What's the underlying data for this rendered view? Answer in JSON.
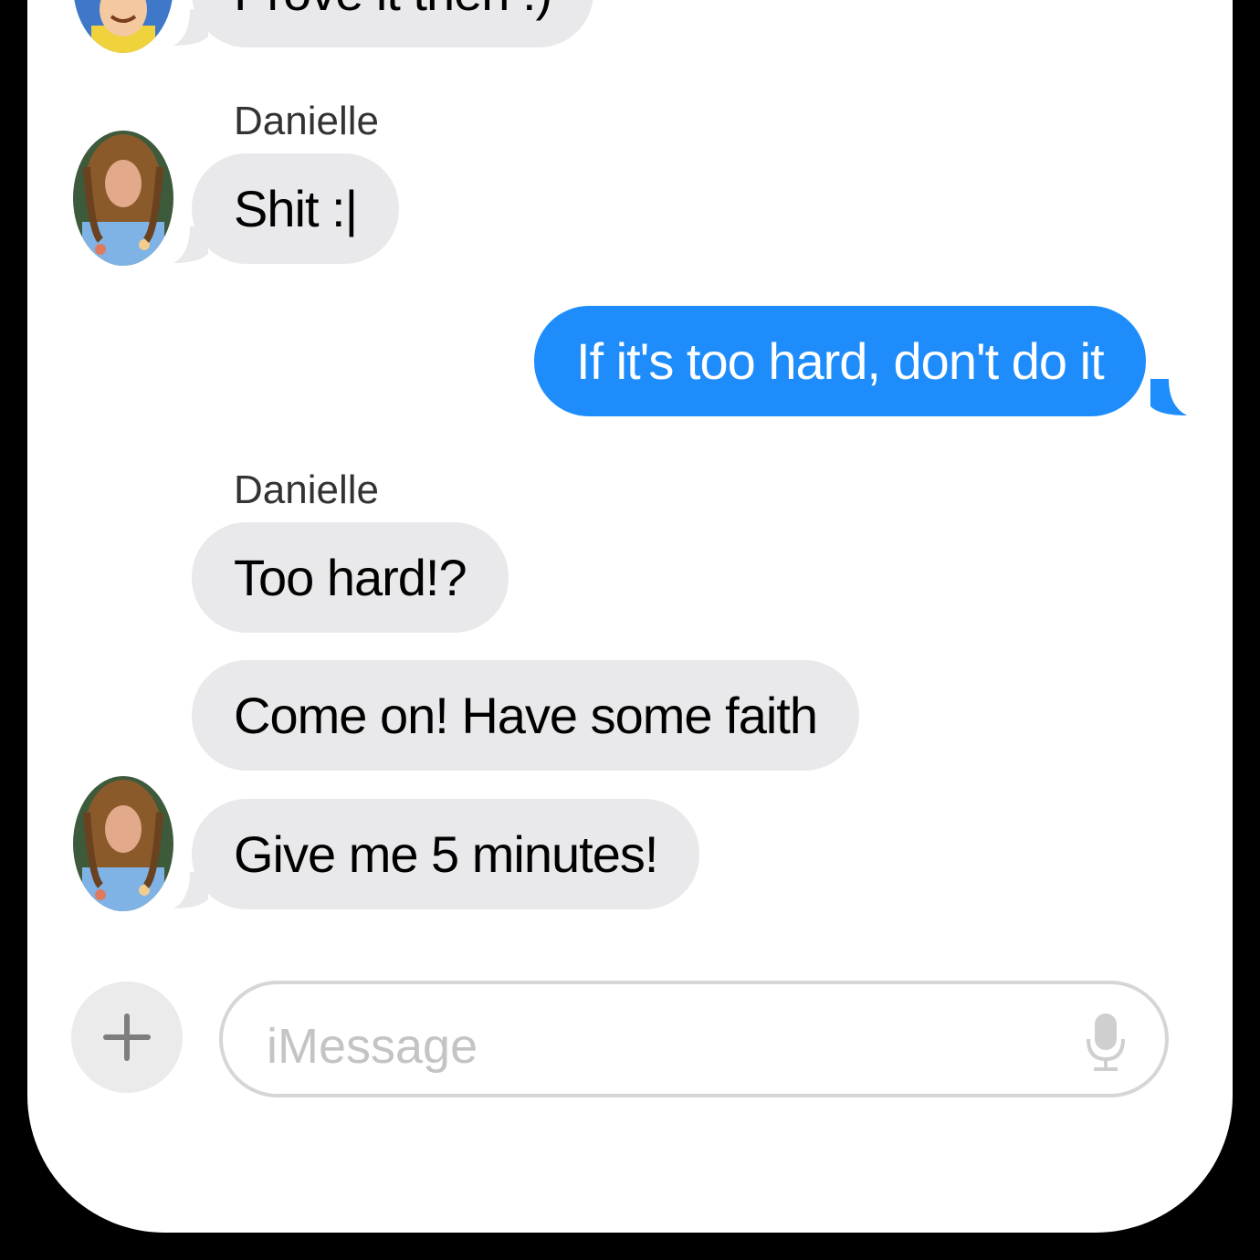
{
  "conversation": {
    "messages": [
      {
        "sender": "",
        "text": "Prove it then :)",
        "direction": "incoming"
      },
      {
        "sender": "Danielle",
        "text": "Shit :|",
        "direction": "incoming"
      },
      {
        "sender": "",
        "text": "If it's too hard, don't do it",
        "direction": "outgoing"
      },
      {
        "sender": "Danielle",
        "text": "Too hard!?",
        "direction": "incoming"
      },
      {
        "sender": "",
        "text": "Come on!  Have some faith",
        "direction": "incoming"
      },
      {
        "sender": "",
        "text": "Give me 5 minutes!",
        "direction": "incoming"
      }
    ]
  },
  "composer": {
    "placeholder": "iMessage",
    "add_icon": "plus-icon",
    "mic_icon": "microphone-icon"
  },
  "colors": {
    "outgoing_bubble": "#1e8dfb",
    "incoming_bubble": "#e9e9eb"
  }
}
